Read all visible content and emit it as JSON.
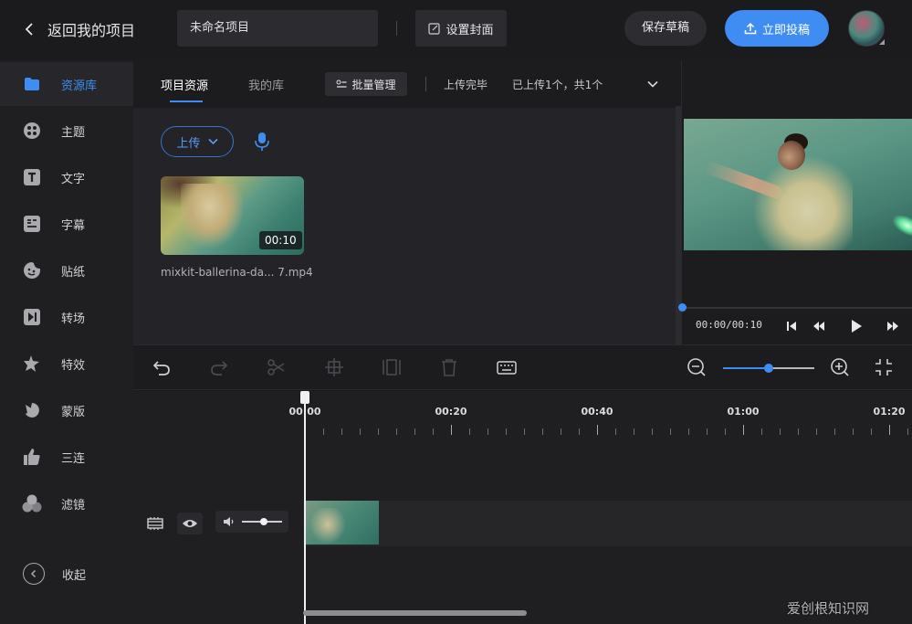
{
  "header": {
    "back_label": "返回我的项目",
    "project_name": "未命名项目",
    "cover_label": "设置封面",
    "save_label": "保存草稿",
    "submit_label": "立即投稿"
  },
  "sidebar": {
    "items": [
      {
        "label": "资源库",
        "icon": "folder-icon",
        "active": true
      },
      {
        "label": "主题",
        "icon": "theme-palette-icon"
      },
      {
        "label": "文字",
        "icon": "text-t-icon"
      },
      {
        "label": "字幕",
        "icon": "subtitle-icon"
      },
      {
        "label": "贴纸",
        "icon": "sticker-icon"
      },
      {
        "label": "转场",
        "icon": "transition-icon"
      },
      {
        "label": "特效",
        "icon": "effects-star-icon"
      },
      {
        "label": "蒙版",
        "icon": "mask-icon"
      },
      {
        "label": "三连",
        "icon": "thumbs-up-icon"
      },
      {
        "label": "滤镜",
        "icon": "filter-circles-icon"
      }
    ],
    "collapse_label": "收起"
  },
  "resources": {
    "tabs": [
      "项目资源",
      "我的库"
    ],
    "batch_label": "批量管理",
    "upload_status": "上传完毕",
    "upload_count": "已上传1个，共1个",
    "upload_button": "上传",
    "clip": {
      "duration": "00:10",
      "name": "mixkit-ballerina-da... 7.mp4"
    }
  },
  "preview": {
    "timecode": "00:00/00:10",
    "progress": 0
  },
  "toolbar": {
    "zoom_level": 0.5
  },
  "timeline": {
    "ruler_labels": [
      "00:00",
      "00:20",
      "00:40",
      "01:00",
      "01:20"
    ]
  },
  "watermark": "爱创根知识网",
  "colors": {
    "accent": "#3f8df3",
    "background": "#1b1b1e",
    "panel": "#242428"
  }
}
